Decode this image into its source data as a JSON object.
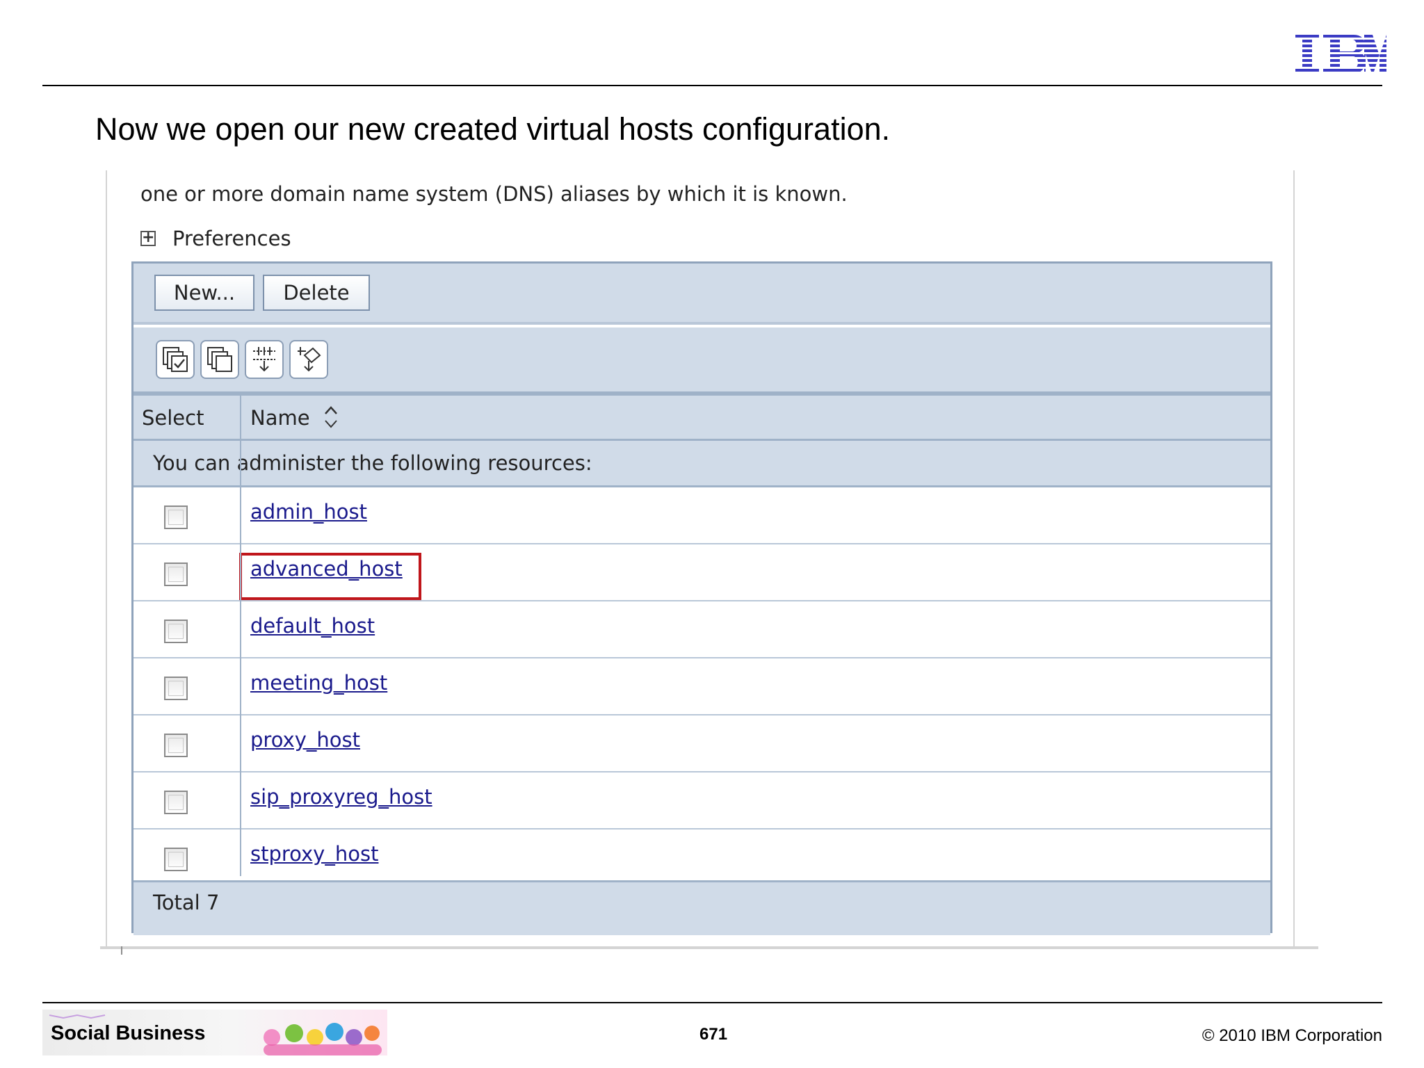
{
  "brand": {
    "logo_text": "IBM",
    "logo_color": "#3b3bc4"
  },
  "slide": {
    "heading": "Now we open our new created virtual hosts configuration."
  },
  "console": {
    "description": "one or more domain name system (DNS) aliases by which it is known.",
    "preferences_label": "Preferences",
    "buttons": {
      "new": "New...",
      "delete": "Delete"
    },
    "toolbar_icons": [
      "select-all-icon",
      "deselect-all-icon",
      "show-filter-icon",
      "clear-filter-icon"
    ],
    "columns": {
      "select": "Select",
      "name": "Name"
    },
    "info_text": "You can administer the following resources:",
    "hosts": [
      {
        "name": "admin_host",
        "checked": false,
        "highlighted": false
      },
      {
        "name": "advanced_host",
        "checked": false,
        "highlighted": true
      },
      {
        "name": "default_host",
        "checked": false,
        "highlighted": false
      },
      {
        "name": "meeting_host",
        "checked": false,
        "highlighted": false
      },
      {
        "name": "proxy_host",
        "checked": false,
        "highlighted": false
      },
      {
        "name": "sip_proxyreg_host",
        "checked": false,
        "highlighted": false
      },
      {
        "name": "stproxy_host",
        "checked": false,
        "highlighted": false
      }
    ],
    "total": "Total 7",
    "colors": {
      "band": "#d0dbe8",
      "border": "#8fa3bb",
      "link": "#1a1a8c",
      "highlight": "#c0161b"
    }
  },
  "footer": {
    "title": "Social Business",
    "page_number": "671",
    "copyright": "© 2010 IBM Corporation"
  }
}
